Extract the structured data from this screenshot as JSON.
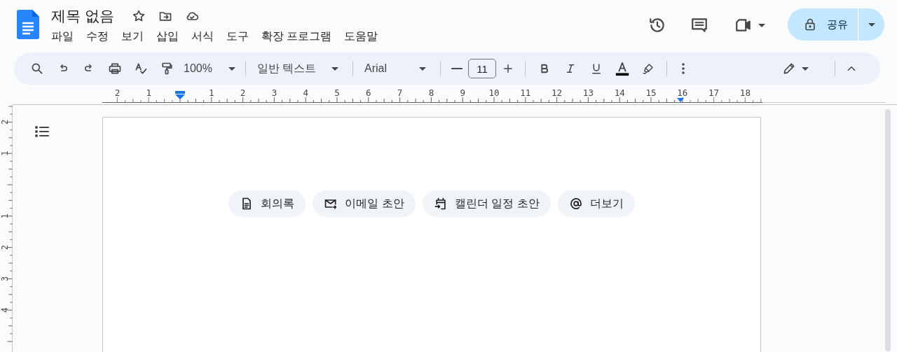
{
  "document": {
    "title": "제목 없음"
  },
  "menu": [
    "파일",
    "수정",
    "보기",
    "삽입",
    "서식",
    "도구",
    "확장 프로그램",
    "도움말"
  ],
  "share": {
    "label": "공유"
  },
  "toolbar": {
    "zoom": "100%",
    "style": "일반 텍스트",
    "font": "Arial",
    "font_size": "11"
  },
  "ruler": {
    "horizontal": [
      "2",
      "1",
      "1",
      "2",
      "3",
      "4",
      "5",
      "6",
      "7",
      "8",
      "9",
      "10",
      "11",
      "12",
      "13",
      "14",
      "15",
      "16",
      "17",
      "18"
    ],
    "vertical": [
      "2",
      "1",
      "1",
      "2",
      "3",
      "4"
    ]
  },
  "chips": [
    {
      "kind": "notes",
      "label": "회의록"
    },
    {
      "kind": "email",
      "label": "이메일 초안"
    },
    {
      "kind": "event",
      "label": "캘린더 일정 초안"
    },
    {
      "kind": "more",
      "label": "더보기"
    }
  ]
}
